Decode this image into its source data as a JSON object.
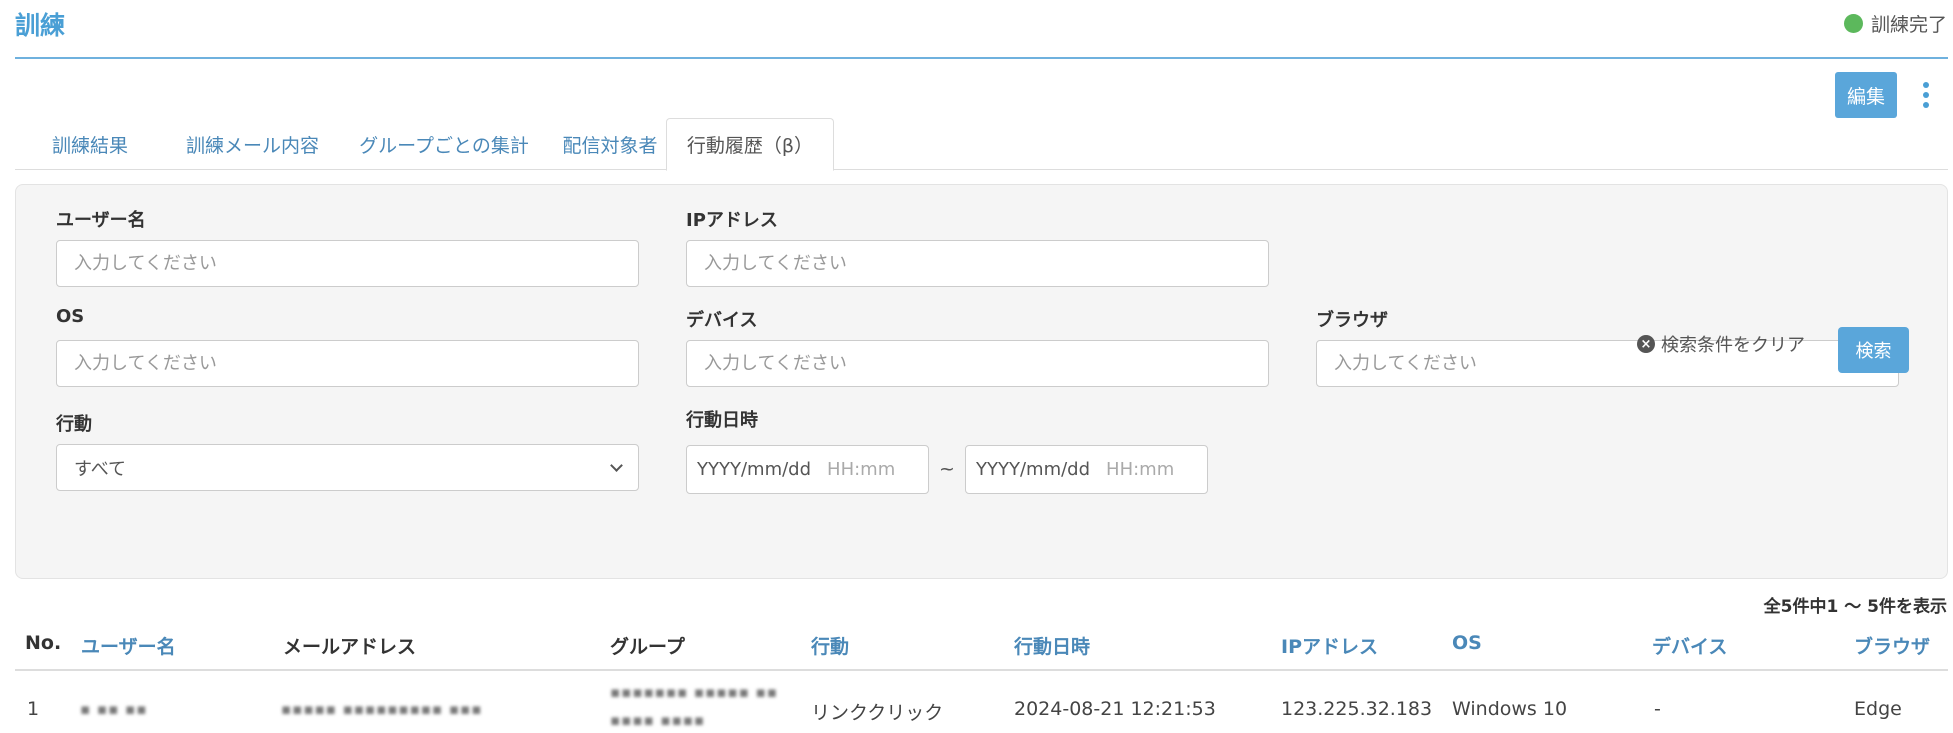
{
  "header": {
    "title": "訓練",
    "status": "訓練完了",
    "status_color": "#5cb85c",
    "edit_label": "編集",
    "more_icon": "kebab-vertical-icon"
  },
  "tabs": [
    {
      "label": "訓練結果",
      "active": false
    },
    {
      "label": "訓練メール内容",
      "active": false
    },
    {
      "label": "グループごとの集計",
      "active": false
    },
    {
      "label": "配信対象者",
      "active": false
    },
    {
      "label": "行動履歴（β）",
      "active": true
    }
  ],
  "filters": {
    "username": {
      "label": "ユーザー名",
      "placeholder": "入力してください"
    },
    "ip": {
      "label": "IPアドレス",
      "placeholder": "入力してください"
    },
    "os": {
      "label": "OS",
      "placeholder": "入力してください"
    },
    "device": {
      "label": "デバイス",
      "placeholder": "入力してください"
    },
    "browser": {
      "label": "ブラウザ",
      "placeholder": "入力してください"
    },
    "action": {
      "label": "行動",
      "selected": "すべて"
    },
    "datetime": {
      "label": "行動日時",
      "from_date": "YYYY/mm/dd",
      "from_time": "HH:mm",
      "separator": "~",
      "to_date": "YYYY/mm/dd",
      "to_time": "HH:mm"
    },
    "clear_label": "検索条件をクリア",
    "search_label": "検索"
  },
  "results": {
    "summary": "全5件中1 〜 5件を表示",
    "columns": [
      "No.",
      "ユーザー名",
      "メールアドレス",
      "グループ",
      "行動",
      "行動日時",
      "IPアドレス",
      "OS",
      "デバイス",
      "ブラウザ"
    ],
    "rows": [
      {
        "no": "1",
        "action": "リンククリック",
        "datetime": "2024-08-21 12:21:53",
        "ip": "123.225.32.183",
        "os": "Windows 10",
        "device": "-",
        "browser": "Edge"
      }
    ]
  },
  "colors": {
    "accent": "#4a9fd5",
    "link": "#4a88b8",
    "button": "#5aa6da"
  }
}
